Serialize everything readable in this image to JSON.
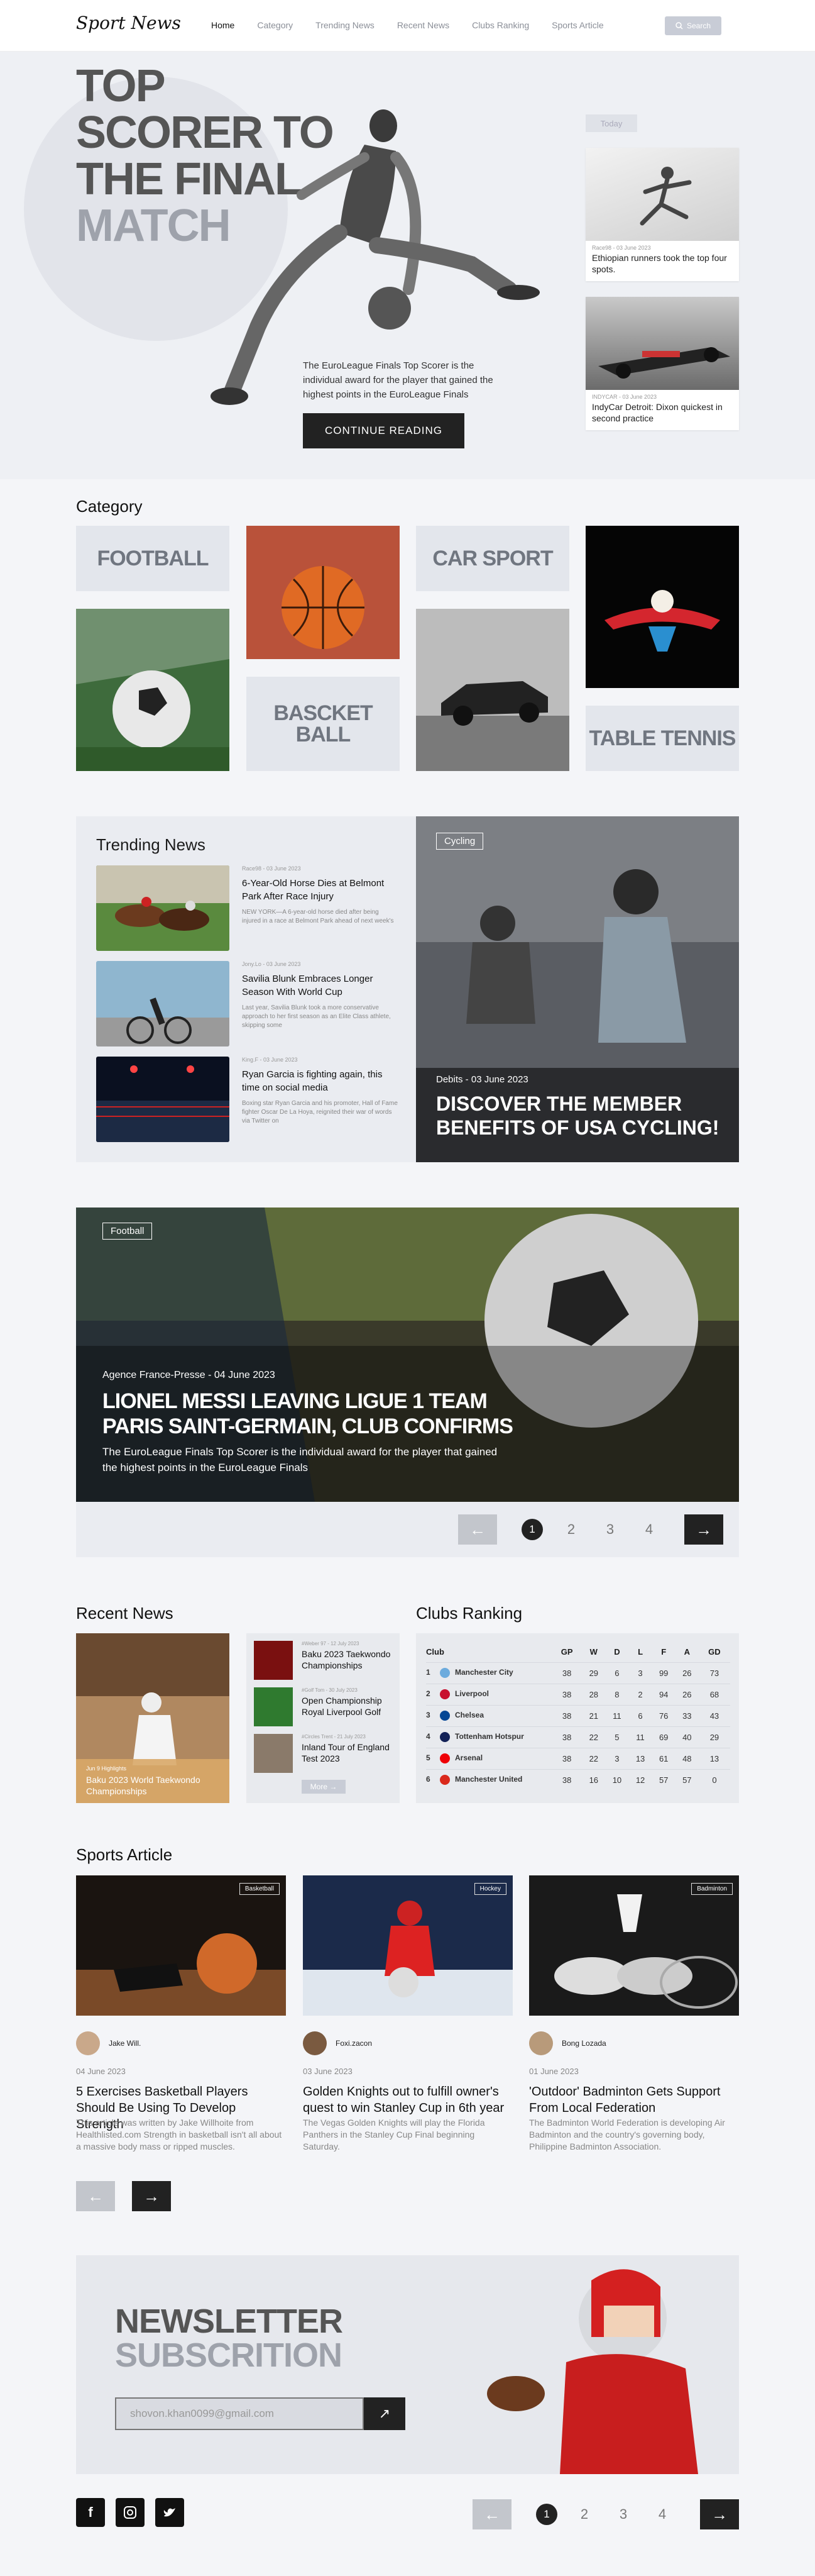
{
  "nav": {
    "logo": "Sport News",
    "links": [
      "Home",
      "Category",
      "Trending News",
      "Recent News",
      "Clubs Ranking",
      "Sports Article"
    ],
    "search": "Search"
  },
  "hero": {
    "title": [
      "TOP",
      "SCORER TO",
      "THE FINAL",
      "MATCH"
    ],
    "desc": "The EuroLeague Finals Top Scorer is the individual award for the player that gained the highest points in the EuroLeague Finals",
    "cta": "CONTINUE READING",
    "today": "Today",
    "side": [
      {
        "meta": "Race98 - 03 June 2023",
        "title": "Ethiopian runners took the top four spots."
      },
      {
        "meta": "INDYCAR - 03 June 2023",
        "title": "IndyCar Detroit: Dixon quickest in second practice"
      }
    ]
  },
  "category": {
    "title": "Category",
    "items": [
      "FOOTBALL",
      "CAR SPORT",
      "BASCKET BALL",
      "TABLE TENNIS"
    ]
  },
  "trending": {
    "title": "Trending News",
    "items": [
      {
        "meta": "Race98 - 03 June 2023",
        "title": "6-Year-Old Horse Dies at Belmont Park After Race Injury",
        "desc": "NEW YORK—A 6-year-old horse died after being injured in a race at Belmont Park ahead of next week's"
      },
      {
        "meta": "Jony.Lo - 03 June 2023",
        "title": "Savilia Blunk Embraces Longer Season With World Cup",
        "desc": "Last year, Savilia Blunk took a more conservative approach to her first season as an Elite Class athlete, skipping some"
      },
      {
        "meta": "King.F - 03 June 2023",
        "title": "Ryan Garcia is fighting again, this time on social media",
        "desc": "Boxing star Ryan Garcia and his promoter, Hall of Fame fighter Oscar De La Hoya, reignited their war of words via Twitter on"
      }
    ]
  },
  "cycling": {
    "tag": "Cycling",
    "meta": "Debits - 03 June 2023",
    "title": "DISCOVER THE MEMBER BENEFITS OF USA CYCLING!"
  },
  "feature": {
    "tag": "Football",
    "meta": "Agence France-Presse - 04 June 2023",
    "title": "LIONEL MESSI LEAVING LIGUE 1 TEAM PARIS SAINT-GERMAIN, CLUB CONFIRMS",
    "desc": "The EuroLeague Finals Top Scorer is the individual award for the player that gained the highest points in the EuroLeague Finals"
  },
  "pages": [
    "1",
    "2",
    "3",
    "4"
  ],
  "recent": {
    "title": "Recent News",
    "big": {
      "meta": "Jun 9 Highlights",
      "title": "Baku 2023 World Taekwondo Championships"
    },
    "items": [
      {
        "meta": "#Weber 97 - 12 July 2023",
        "title": "Baku 2023 Taekwondo Championships"
      },
      {
        "meta": "#Golf Tom - 30 July 2023",
        "title": "Open Championship Royal Liverpool Golf"
      },
      {
        "meta": "#Circles Trent - 21 July 2023",
        "title": "Inland Tour of England Test 2023"
      }
    ],
    "more": "More"
  },
  "clubs": {
    "title": "Clubs Ranking",
    "headers": [
      "Club",
      "GP",
      "W",
      "D",
      "L",
      "F",
      "A",
      "GD"
    ],
    "rows": [
      [
        "1",
        "Manchester City",
        "38",
        "29",
        "6",
        "3",
        "99",
        "26",
        "73"
      ],
      [
        "2",
        "Liverpool",
        "38",
        "28",
        "8",
        "2",
        "94",
        "26",
        "68"
      ],
      [
        "3",
        "Chelsea",
        "38",
        "21",
        "11",
        "6",
        "76",
        "33",
        "43"
      ],
      [
        "4",
        "Tottenham Hotspur",
        "38",
        "22",
        "5",
        "11",
        "69",
        "40",
        "29"
      ],
      [
        "5",
        "Arsenal",
        "38",
        "22",
        "3",
        "13",
        "61",
        "48",
        "13"
      ],
      [
        "6",
        "Manchester United",
        "38",
        "16",
        "10",
        "12",
        "57",
        "57",
        "0"
      ]
    ],
    "colors": [
      "#6cabdd",
      "#c8102e",
      "#034694",
      "#132257",
      "#ef0107",
      "#da291c"
    ]
  },
  "articles": {
    "title": "Sports Article",
    "items": [
      {
        "tag": "Basketball",
        "author": "Jake Will.",
        "date": "04 June 2023",
        "title": "5 Exercises Basketball Players Should Be Using To Develop Strength",
        "desc": "This article was written by Jake Willhoite from Healthlisted.com Strength in basketball isn't all about a massive body mass or ripped muscles."
      },
      {
        "tag": "Hockey",
        "author": "Foxi.zacon",
        "date": "03 June 2023",
        "title": "Golden Knights out to fulfill owner's quest to win Stanley Cup in 6th year",
        "desc": "The Vegas Golden Knights will play the Florida Panthers in the Stanley Cup Final beginning Saturday."
      },
      {
        "tag": "Badminton",
        "author": "Bong Lozada",
        "date": "01 June 2023",
        "title": "'Outdoor' Badminton Gets Support From Local Federation",
        "desc": "The Badminton World Federation is developing Air Badminton and the country's governing body, Philippine Badminton Association."
      }
    ]
  },
  "newsletter": {
    "title1": "NEWSLETTER",
    "title2": "SUBSCRITION",
    "email": "shovon.khan0099@gmail.com"
  }
}
